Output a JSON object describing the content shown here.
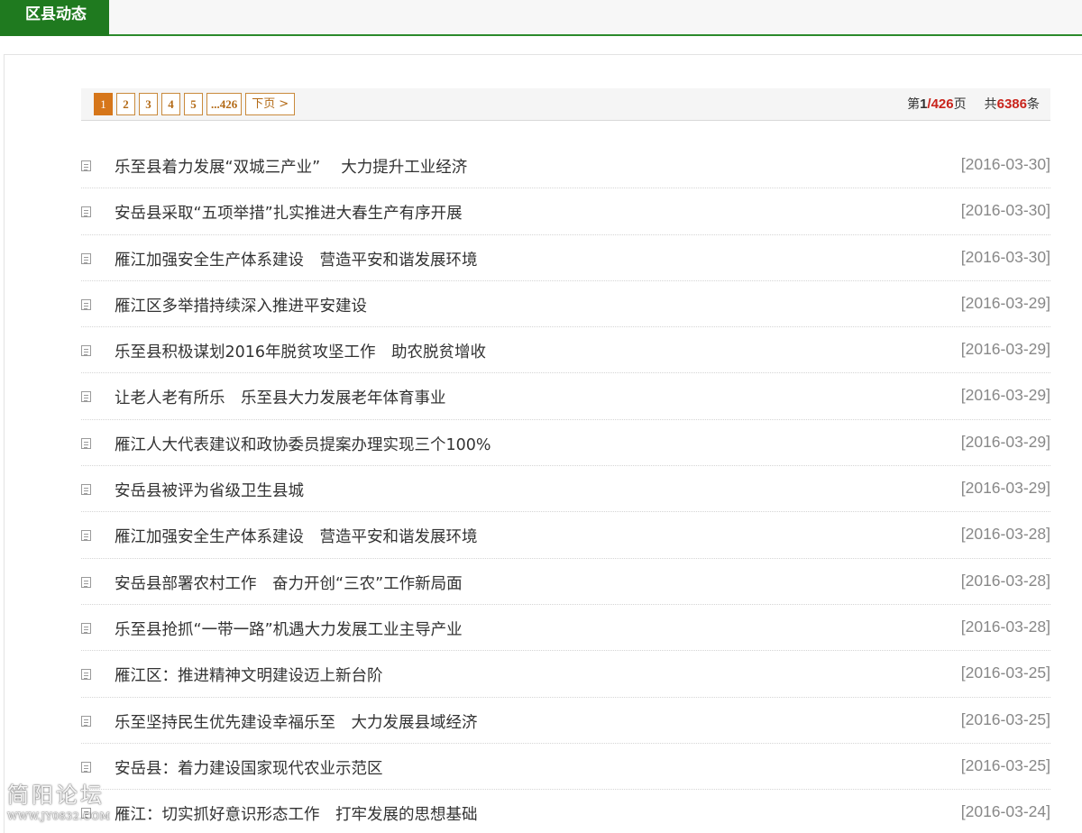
{
  "section": {
    "title": "区县动态"
  },
  "pagination": {
    "pages": [
      "1",
      "2",
      "3",
      "4",
      "5",
      "...426"
    ],
    "current_page": "1",
    "next_label": "下页",
    "next_arrow": ">",
    "info": {
      "prefix": "第",
      "current": "1",
      "sep": "/",
      "total_pages": "426",
      "pages_suffix": "页",
      "total_prefix": "共",
      "total_items": "6386",
      "items_suffix": "条"
    }
  },
  "news": [
    {
      "title": "乐至县着力发展“双城三产业”　 大力提升工业经济",
      "date": "[2016-03-30]"
    },
    {
      "title": "安岳县采取“五项举措”扎实推进大春生产有序开展",
      "date": "[2016-03-30]"
    },
    {
      "title": "雁江加强安全生产体系建设　营造平安和谐发展环境",
      "date": "[2016-03-30]"
    },
    {
      "title": "雁江区多举措持续深入推进平安建设",
      "date": "[2016-03-29]"
    },
    {
      "title": "乐至县积极谋划2016年脱贫攻坚工作　助农脱贫增收",
      "date": "[2016-03-29]"
    },
    {
      "title": "让老人老有所乐　乐至县大力发展老年体育事业",
      "date": "[2016-03-29]"
    },
    {
      "title": "雁江人大代表建议和政协委员提案办理实现三个100%",
      "date": "[2016-03-29]"
    },
    {
      "title": "安岳县被评为省级卫生县城",
      "date": "[2016-03-29]"
    },
    {
      "title": "雁江加强安全生产体系建设　营造平安和谐发展环境",
      "date": "[2016-03-28]"
    },
    {
      "title": "安岳县部署农村工作　奋力开创“三农”工作新局面",
      "date": "[2016-03-28]"
    },
    {
      "title": "乐至县抢抓“一带一路”机遇大力发展工业主导产业",
      "date": "[2016-03-28]"
    },
    {
      "title": "雁江区：推进精神文明建设迈上新台阶",
      "date": "[2016-03-25]"
    },
    {
      "title": "乐至坚持民生优先建设幸福乐至　大力发展县域经济",
      "date": "[2016-03-25]"
    },
    {
      "title": "安岳县：着力建设国家现代农业示范区",
      "date": "[2016-03-25]"
    },
    {
      "title": "雁江：切实抓好意识形态工作　打牢发展的思想基础",
      "date": "[2016-03-24]"
    }
  ],
  "watermark": {
    "name": "简阳论坛",
    "url": "WWW.JY0832.COM"
  }
}
